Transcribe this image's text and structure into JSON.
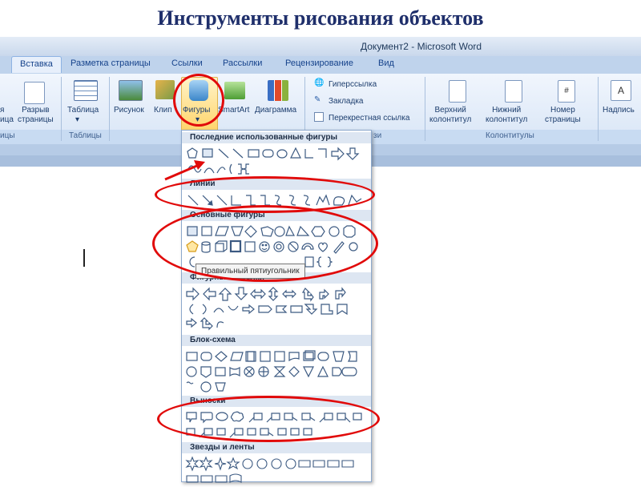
{
  "slide": {
    "title": "Инструменты рисования объектов"
  },
  "window": {
    "title": "Документ2 - Microsoft Word"
  },
  "tabs": [
    {
      "label": "Вставка",
      "active": true
    },
    {
      "label": "Разметка страницы"
    },
    {
      "label": "Ссылки"
    },
    {
      "label": "Рассылки"
    },
    {
      "label": "Рецензирование"
    },
    {
      "label": "Вид"
    }
  ],
  "ribbon": {
    "page_break": "Разрыв\nстраницы",
    "page_cut_left": "я\nица",
    "table": "Таблица",
    "picture": "Рисунок",
    "clip": "Клип",
    "shapes": "Фигуры",
    "smartart": "SmartArt",
    "chart": "Диаграмма",
    "hyperlink": "Гиперссылка",
    "bookmark": "Закладка",
    "crossref": "Перекрестная ссылка",
    "header": "Верхний\nколонтитул",
    "footer": "Нижний\nколонтитул",
    "page_number": "Номер\nстраницы",
    "caption": "Надпись",
    "groups": {
      "pages_cut": "ицы",
      "tables": "Таблицы",
      "links_cut": "зи",
      "headers_footers": "Колонтитулы"
    }
  },
  "gallery": {
    "sections": [
      "Последние использованные фигуры",
      "Линии",
      "Основные фигуры",
      "Фигурные стрелки",
      "Блок-схема",
      "Выноски",
      "Звезды и ленты"
    ],
    "tooltip": "Правильный пятиугольник"
  },
  "colors": {
    "accent": "#e10a0a",
    "title": "#1f2f6b",
    "ribbon": "#d8e5f6"
  }
}
